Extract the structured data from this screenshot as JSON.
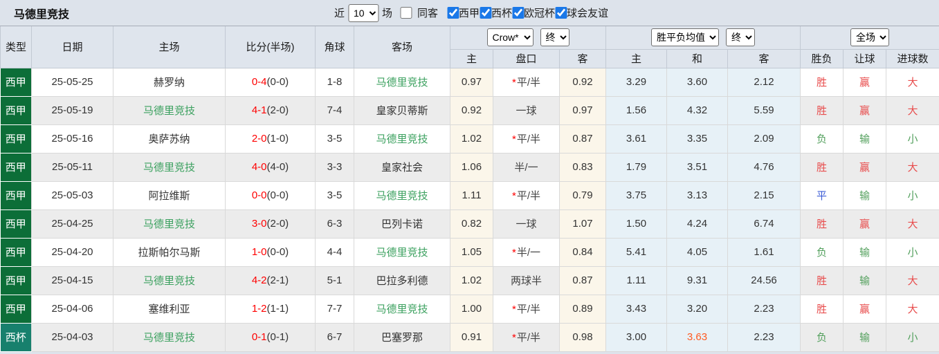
{
  "title": "马德里竞技",
  "highlight_team": "马德里竞技",
  "accent_colors": {
    "team_highlight": "#3aa05e",
    "score_red": "#fe0000",
    "avg_highlight_orange": "#ff5a22",
    "checkbox_blue": "#1a78e8"
  },
  "toolbar": {
    "recent_label": "近",
    "recent_value": "10",
    "matches_label": "场",
    "same_venue": {
      "label": "同客",
      "checked": false
    },
    "league_filters": [
      {
        "label": "西甲",
        "checked": true
      },
      {
        "label": "西杯",
        "checked": true
      },
      {
        "label": "欧冠杯",
        "checked": true
      },
      {
        "label": "球会友谊",
        "checked": true
      }
    ]
  },
  "table": {
    "columns": [
      "类型",
      "日期",
      "主场",
      "比分(半场)",
      "角球",
      "客场"
    ],
    "odds_selects": {
      "company": "Crow*",
      "company_time": "终",
      "avg": "胜平负均值",
      "avg_time": "终",
      "scope": "全场"
    },
    "sub_columns": [
      "主",
      "盘口",
      "客",
      "主",
      "和",
      "客",
      "胜负",
      "让球",
      "进球数"
    ],
    "league_colors": {
      "西甲": "#0c6e38",
      "西杯": "#17806d"
    },
    "result_colors": {
      "胜": "#e84c4c",
      "赢": "#e84c4c",
      "大": "#e84c4c",
      "负": "#53a05d",
      "输": "#53a05d",
      "小": "#53a05d",
      "平": "#3b5bd5"
    },
    "rows": [
      {
        "league": "西甲",
        "date": "25-05-25",
        "home": "赫罗纳",
        "score": "0-4",
        "half": "(0-0)",
        "corner": "1-8",
        "away": "马德里竞技",
        "odds_home": "0.97",
        "handicap": "平/半",
        "handicap_star": true,
        "odds_away": "0.92",
        "avg": [
          "3.29",
          "3.60",
          "2.12"
        ],
        "avg_hl": [
          false,
          false,
          false
        ],
        "results": [
          "胜",
          "赢",
          "大"
        ]
      },
      {
        "league": "西甲",
        "date": "25-05-19",
        "home": "马德里竞技",
        "score": "4-1",
        "half": "(2-0)",
        "corner": "7-4",
        "away": "皇家贝蒂斯",
        "odds_home": "0.92",
        "handicap": "一球",
        "handicap_star": false,
        "odds_away": "0.97",
        "avg": [
          "1.56",
          "4.32",
          "5.59"
        ],
        "avg_hl": [
          false,
          false,
          false
        ],
        "results": [
          "胜",
          "赢",
          "大"
        ]
      },
      {
        "league": "西甲",
        "date": "25-05-16",
        "home": "奥萨苏纳",
        "score": "2-0",
        "half": "(1-0)",
        "corner": "3-5",
        "away": "马德里竞技",
        "odds_home": "1.02",
        "handicap": "平/半",
        "handicap_star": true,
        "odds_away": "0.87",
        "avg": [
          "3.61",
          "3.35",
          "2.09"
        ],
        "avg_hl": [
          false,
          false,
          false
        ],
        "results": [
          "负",
          "输",
          "小"
        ]
      },
      {
        "league": "西甲",
        "date": "25-05-11",
        "home": "马德里竞技",
        "score": "4-0",
        "half": "(4-0)",
        "corner": "3-3",
        "away": "皇家社会",
        "odds_home": "1.06",
        "handicap": "半/一",
        "handicap_star": false,
        "odds_away": "0.83",
        "avg": [
          "1.79",
          "3.51",
          "4.76"
        ],
        "avg_hl": [
          false,
          false,
          false
        ],
        "results": [
          "胜",
          "赢",
          "大"
        ]
      },
      {
        "league": "西甲",
        "date": "25-05-03",
        "home": "阿拉维斯",
        "score": "0-0",
        "half": "(0-0)",
        "corner": "3-5",
        "away": "马德里竞技",
        "odds_home": "1.11",
        "handicap": "平/半",
        "handicap_star": true,
        "odds_away": "0.79",
        "avg": [
          "3.75",
          "3.13",
          "2.15"
        ],
        "avg_hl": [
          false,
          false,
          false
        ],
        "results": [
          "平",
          "输",
          "小"
        ]
      },
      {
        "league": "西甲",
        "date": "25-04-25",
        "home": "马德里竞技",
        "score": "3-0",
        "half": "(2-0)",
        "corner": "6-3",
        "away": "巴列卡诺",
        "odds_home": "0.82",
        "handicap": "一球",
        "handicap_star": false,
        "odds_away": "1.07",
        "avg": [
          "1.50",
          "4.24",
          "6.74"
        ],
        "avg_hl": [
          false,
          false,
          false
        ],
        "results": [
          "胜",
          "赢",
          "大"
        ]
      },
      {
        "league": "西甲",
        "date": "25-04-20",
        "home": "拉斯帕尔马斯",
        "score": "1-0",
        "half": "(0-0)",
        "corner": "4-4",
        "away": "马德里竞技",
        "odds_home": "1.05",
        "handicap": "半/一",
        "handicap_star": true,
        "odds_away": "0.84",
        "avg": [
          "5.41",
          "4.05",
          "1.61"
        ],
        "avg_hl": [
          false,
          false,
          false
        ],
        "results": [
          "负",
          "输",
          "小"
        ]
      },
      {
        "league": "西甲",
        "date": "25-04-15",
        "home": "马德里竞技",
        "score": "4-2",
        "half": "(2-1)",
        "corner": "5-1",
        "away": "巴拉多利德",
        "odds_home": "1.02",
        "handicap": "两球半",
        "handicap_star": false,
        "odds_away": "0.87",
        "avg": [
          "1.11",
          "9.31",
          "24.56"
        ],
        "avg_hl": [
          false,
          false,
          false
        ],
        "results": [
          "胜",
          "输",
          "大"
        ]
      },
      {
        "league": "西甲",
        "date": "25-04-06",
        "home": "塞维利亚",
        "score": "1-2",
        "half": "(1-1)",
        "corner": "7-7",
        "away": "马德里竞技",
        "odds_home": "1.00",
        "handicap": "平/半",
        "handicap_star": true,
        "odds_away": "0.89",
        "avg": [
          "3.43",
          "3.20",
          "2.23"
        ],
        "avg_hl": [
          false,
          false,
          false
        ],
        "results": [
          "胜",
          "赢",
          "大"
        ]
      },
      {
        "league": "西杯",
        "date": "25-04-03",
        "home": "马德里竞技",
        "score": "0-1",
        "half": "(0-1)",
        "corner": "6-7",
        "away": "巴塞罗那",
        "odds_home": "0.91",
        "handicap": "平/半",
        "handicap_star": true,
        "odds_away": "0.98",
        "avg": [
          "3.00",
          "3.63",
          "2.23"
        ],
        "avg_hl": [
          false,
          true,
          false
        ],
        "results": [
          "负",
          "输",
          "小"
        ]
      }
    ]
  }
}
